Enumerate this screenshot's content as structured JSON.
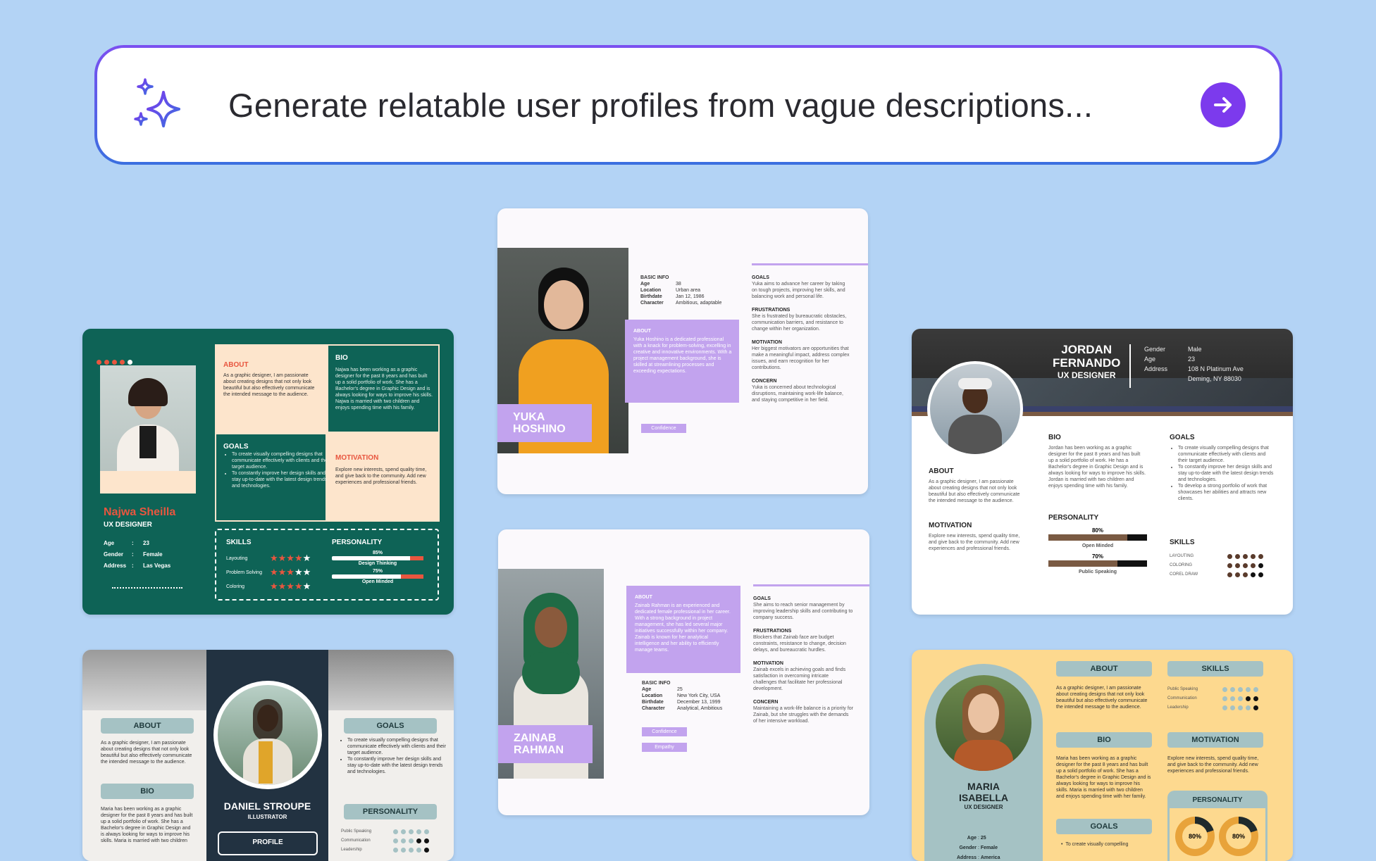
{
  "search": {
    "prompt": "Generate relatable user profiles from vague descriptions...",
    "sparkle_icon": "sparkles-icon",
    "submit_icon": "arrow-right-icon",
    "accent": "#7c3aed"
  },
  "najwa": {
    "about_h": "ABOUT",
    "about_t": "As a graphic designer, I am passionate about creating designs that not only look beautiful but also effectively communicate the intended message to the audience.",
    "bio_h": "BIO",
    "bio_t": "Najwa has been working as a graphic designer for the past 8 years and has built up a solid portfolio of work. She has a Bachelor's degree in Graphic Design and is always looking for ways to improve his skills. Najwa is married with two children and enjoys spending time with his family.",
    "goals_h": "GOALS",
    "goals": [
      "To create visually compelling designs that communicate effectively with clients and their target audience.",
      "To constantly improve her design skills and stay up-to-date with the latest design trends and technologies."
    ],
    "motivation_h": "MOTIVATION",
    "motivation_t": "Explore new interests, spend quality time, and give back to the community. Add new experiences and professional friends.",
    "name": "Najwa Sheilla",
    "role": "UX DESIGNER",
    "info": [
      {
        "k": "Age",
        "v": "23"
      },
      {
        "k": "Gender",
        "v": "Female"
      },
      {
        "k": "Address",
        "v": "Las Vegas"
      }
    ],
    "skills_h": "SKILLS",
    "skills": [
      {
        "label": "Layouting",
        "stars": 4
      },
      {
        "label": "Problem Solving",
        "stars": 3
      },
      {
        "label": "Coloring",
        "stars": 4
      }
    ],
    "personality_h": "PERSONALITY",
    "personality": [
      {
        "pct": "85%",
        "label": "Design Thinking",
        "value": 0.85
      },
      {
        "pct": "75%",
        "label": "Open Minded",
        "value": 0.75
      }
    ]
  },
  "yuka": {
    "basic_h": "BASIC INFO",
    "basic": [
      {
        "k": "Age",
        "v": "38"
      },
      {
        "k": "Location",
        "v": "Urban area"
      },
      {
        "k": "Birthdate",
        "v": "Jan 12, 1986"
      },
      {
        "k": "Character",
        "v": "Ambitious, adaptable"
      }
    ],
    "about_h": "ABOUT",
    "about_t": "Yuka Hoshino is a dedicated professional with a knack for problem-solving, excelling in creative and innovative environments. With a project management background, she is skilled at streamlining processes and exceeding expectations.",
    "name1": "YUKA",
    "name2": "HOSHINO",
    "tag": "Confidence",
    "goals_h": "GOALS",
    "goals_t": "Yuka aims to advance her career by taking on tough projects, improving her skills, and balancing work and personal life.",
    "frus_h": "FRUSTRATIONS",
    "frus_t": "She is frustrated by bureaucratic obstacles, communication barriers, and resistance to change within her organization.",
    "mot_h": "MOTIVATION",
    "mot_t": "Her biggest motivators are opportunities that make a meaningful impact, address complex issues, and earn recognition for her contributions.",
    "con_h": "CONCERN",
    "con_t": "Yuka is concerned about technological disruptions, maintaining work-life balance, and staying competitive in her field."
  },
  "jordan": {
    "name1": "JORDAN",
    "name2": "FERNANDO",
    "role": "UX DESIGNER",
    "info": [
      {
        "k": "Gender",
        "v": "Male"
      },
      {
        "k": "Age",
        "v": "23"
      },
      {
        "k": "Address",
        "v": "108 N Platinum Ave"
      },
      {
        "k": "",
        "v": "Deming, NY 88030"
      }
    ],
    "about_h": "ABOUT",
    "about_t": "As a graphic designer, I am passionate about creating designs that not only look beautiful but also effectively communicate the intended message to the audience.",
    "bio_h": "BIO",
    "bio_t": "Jordan has been working as a graphic designer for the past 8 years and has built up a solid portfolio of work. He has a Bachelor's degree in Graphic Design and is always looking for ways to improve his skills. Jordan is married with two children and enjoys spending time with his family.",
    "goals_h": "GOALS",
    "goals": [
      "To create visually compelling designs that communicate effectively with clients and their target audience.",
      "To constantly improve her design skills and stay up-to-date with the latest design trends and technologies.",
      "To develop a strong portfolio of work that showcases her abilities and attracts new clients."
    ],
    "motivation_h": "MOTIVATION",
    "motivation_t": "Explore new interests, spend quality time, and give back to the community. Add new experiences and professional friends.",
    "personality_h": "PERSONALITY",
    "personality": [
      {
        "pct": "80%",
        "label": "Open Minded",
        "value": 0.8
      },
      {
        "pct": "70%",
        "label": "Public Speaking",
        "value": 0.7
      }
    ],
    "skills_h": "SKILLS",
    "skills": [
      {
        "label": "LAYOUTING",
        "level": 5
      },
      {
        "label": "COLORING",
        "level": 4
      },
      {
        "label": "COREL DRAW",
        "level": 3
      }
    ]
  },
  "daniel": {
    "about_h": "ABOUT",
    "about_t": "As a graphic designer, I am passionate about creating designs that not only look beautiful but also effectively communicate the intended message to the audience.",
    "bio_h": "BIO",
    "bio_t": "Maria has been working as a graphic designer for the past 8 years and has built up a solid portfolio of work. She has a Bachelor's degree in Graphic Design and is always looking for ways to improve his skills. Maria is married with two children",
    "name": "DANIEL STROUPE",
    "role": "ILLUSTRATOR",
    "profile_h": "PROFILE",
    "goals_h": "GOALS",
    "goals": [
      "To create visually compelling designs that communicate effectively with clients and their target audience.",
      "To constantly improve her design skills and stay up-to-date with the latest design trends and technologies."
    ],
    "personality_h": "PERSONALITY",
    "personality": [
      {
        "label": "Public Speaking",
        "level": 4
      },
      {
        "label": "Communication",
        "level": 3
      },
      {
        "label": "Leadership",
        "level": 4
      }
    ]
  },
  "zainab": {
    "about_h": "ABOUT",
    "about_t": "Zainab Rahman is an experienced and dedicated female professional in her career. With a strong background in project management, she has led several major initiatives successfully within her company. Zainab is known for her analytical intelligence and her ability to efficiently manage teams.",
    "basic_h": "BASIC INFO",
    "basic": [
      {
        "k": "Age",
        "v": "25"
      },
      {
        "k": "Location",
        "v": "New York City, USA"
      },
      {
        "k": "Birthdate",
        "v": "December 13, 1999"
      },
      {
        "k": "Character",
        "v": "Analytical, Ambitious"
      }
    ],
    "tags": [
      "Confidence",
      "Empathy"
    ],
    "name1": "ZAINAB",
    "name2": "RAHMAN",
    "goals_h": "GOALS",
    "goals_t": "She aims to reach senior management by improving leadership skills and contributing to company success.",
    "frus_h": "FRUSTRATIONS",
    "frus_t": "Blockers that Zainab face are budget constraints, resistance to change, decision delays, and bureaucratic hurdles.",
    "mot_h": "MOTIVATION",
    "mot_t": "Zainab excels in achieving goals and finds satisfaction in overcoming intricate challenges that facilitate her professional development.",
    "con_h": "CONCERN",
    "con_t": "Maintaining a work-life balance is a priority for Zainab, but she struggles with the demands of her intensive workload."
  },
  "maria": {
    "name1": "MARIA",
    "name2": "ISABELLA",
    "role": "UX DESIGNER",
    "info": [
      {
        "k": "Age",
        "v": "25"
      },
      {
        "k": "Gender",
        "v": "Female"
      },
      {
        "k": "Address",
        "v": "America"
      }
    ],
    "about_h": "ABOUT",
    "about_t": "As a graphic designer, I am passionate about creating designs that not only look beautiful but also effectively communicate the intended message to the audience.",
    "bio_h": "BIO",
    "bio_t": "Maria has been working as a graphic designer for the past 8 years and has built up a solid portfolio of work. She has a Bachelor's degree in Graphic Design and is always looking for ways to improve his skills. Maria is married with two children and enjoys spending time with her family.",
    "goals_h": "GOALS",
    "goals_t": "To create visually compelling",
    "skills_h": "SKILLS",
    "skills": [
      {
        "label": "Public Speaking",
        "level": 3
      },
      {
        "label": "Communication",
        "level": 4
      },
      {
        "label": "Leadership",
        "level": 3
      }
    ],
    "motivation_h": "MOTIVATION",
    "motivation_t": "Explore new interests, spend quality time, and give back to the community. Add new experiences and professional friends.",
    "personality_h": "PERSONALITY",
    "personality": [
      {
        "pct": "80%",
        "value": 0.8
      },
      {
        "pct": "80%",
        "value": 0.8
      }
    ]
  }
}
